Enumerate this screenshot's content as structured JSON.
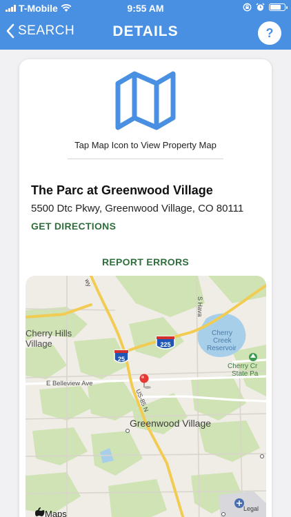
{
  "status_bar": {
    "carrier": "T-Mobile",
    "time": "9:55 AM"
  },
  "nav": {
    "back_label": "SEARCH",
    "title": "DETAILS",
    "help_label": "?"
  },
  "detail": {
    "map_hint": "Tap Map Icon to View Property Map",
    "property_name": "The Parc at Greenwood Village",
    "address": "5500 Dtc Pkwy, Greenwood Village, CO 80111",
    "directions_label": "GET DIRECTIONS",
    "report_label": "REPORT ERRORS"
  },
  "map": {
    "labels": {
      "cherry_hills_1": "Cherry Hills",
      "cherry_hills_2": "Village",
      "belleview": "E Belleview Ave",
      "greenwood": "Greenwood Village",
      "reservoir_1": "Cherry",
      "reservoir_2": "Creek",
      "reservoir_3": "Reservoir",
      "state_park_1": "Cherry Cr",
      "state_park_2": "State Pa",
      "us85": "US-85 N",
      "i25": "25",
      "i225": "225",
      "havana": "S Hava",
      "hwy": "wy",
      "legal": "Legal",
      "maps_brand": "Maps"
    }
  },
  "colors": {
    "nav_blue": "#4a90e2",
    "action_green": "#2f6d3d",
    "map_icon_blue": "#4a90e2",
    "pin_red": "#e53935"
  },
  "icons": {
    "back": "chevron-left-icon",
    "map": "folded-map-icon",
    "help": "question-icon",
    "pin": "map-pin-icon",
    "wifi": "wifi-icon",
    "alarm": "alarm-icon",
    "lock": "orientation-lock-icon",
    "battery": "battery-icon"
  }
}
